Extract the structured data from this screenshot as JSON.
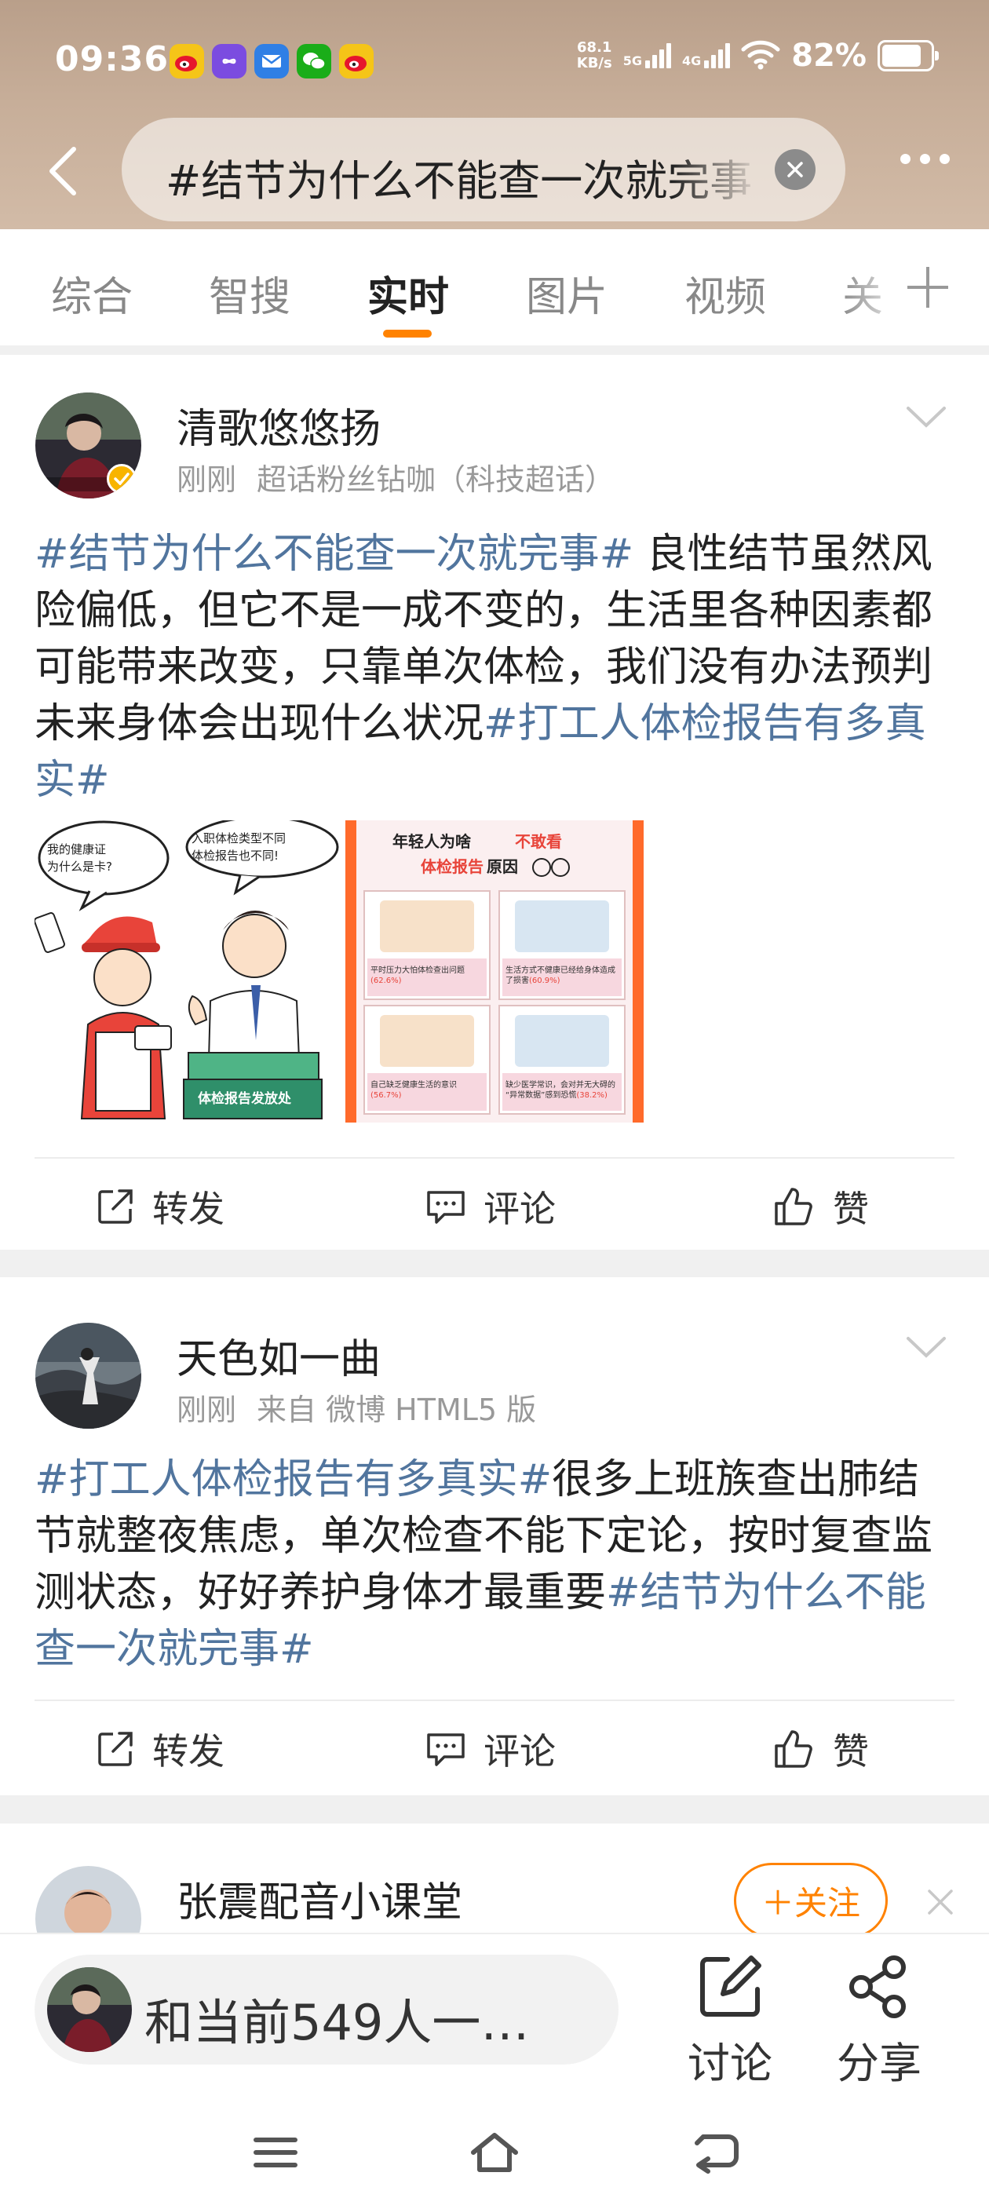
{
  "status_bar": {
    "time": "09:36",
    "net_speed_value": "68.1",
    "net_speed_unit": "KB/s",
    "signal_1": "5G",
    "signal_2": "4G",
    "battery_percent": "82%",
    "battery_level": 0.82,
    "app_icons": [
      "weibo-icon",
      "music-icon",
      "mail-icon",
      "wechat-icon",
      "weibo-icon"
    ]
  },
  "search": {
    "query": "#结节为什么不能查一次就完事"
  },
  "tabs": [
    {
      "label": "综合",
      "active": false
    },
    {
      "label": "智搜",
      "active": false
    },
    {
      "label": "实时",
      "active": true
    },
    {
      "label": "图片",
      "active": false
    },
    {
      "label": "视频",
      "active": false
    },
    {
      "label": "关",
      "active": false
    }
  ],
  "posts": [
    {
      "author": "清歌悠悠扬",
      "time": "刚刚",
      "source": "超话粉丝钻咖（科技超话）",
      "text_parts": [
        {
          "t": "#结节为什么不能查一次就完事#",
          "tag": true
        },
        {
          "t": " 良性结节虽然风险偏低，但它不是一成不变的，生活里各种因素都可能带来改变，只靠单次体检，我们没有办法预判未来身体会出现什么状况",
          "tag": false
        },
        {
          "t": "#打工人体检报告有多真实#",
          "tag": true
        }
      ],
      "image_1": {
        "bubble_left": "我的健康证为什么是卡?",
        "bubble_right": "入职体检类型不同体检报告也不同!",
        "counter_sign": "体检报告发放处"
      },
      "image_2": {
        "title_1": "年轻人为啥",
        "title_highlight_1": "不敢看",
        "title_2": "体检报告",
        "title_highlight_2": "原因",
        "cells": [
          {
            "text": "平时压力大怕体检查出问题",
            "pct": "(62.6%)"
          },
          {
            "text": "生活方式不健康已经给身体造成了损害",
            "pct": "(60.9%)"
          },
          {
            "text": "自己缺乏健康生活的意识",
            "pct": "(56.7%)"
          },
          {
            "text": "缺少医学常识，会对并无大碍的“异常数据”感到恐慌",
            "pct": "(38.2%)"
          }
        ]
      },
      "actions": {
        "repost": "转发",
        "comment": "评论",
        "like": "赞"
      }
    },
    {
      "author": "天色如一曲",
      "time": "刚刚",
      "source": "来自 微博 HTML5 版",
      "text_parts": [
        {
          "t": "#打工人体检报告有多真实#",
          "tag": true
        },
        {
          "t": "很多上班族查出肺结节就整夜焦虑，单次检查不能下定论，按时复查监测状态，好好养护身体才最重要",
          "tag": false
        },
        {
          "t": "#结节为什么不能查一次就完事#",
          "tag": true
        }
      ],
      "actions": {
        "repost": "转发",
        "comment": "评论",
        "like": "赞"
      }
    },
    {
      "author": "张震配音小课堂",
      "follow_label": "＋关注"
    }
  ],
  "bottom_bar": {
    "chat_text": "和当前549人一…",
    "discuss_label": "讨论",
    "share_label": "分享"
  },
  "colors": {
    "accent": "#ff8200",
    "tag": "#51759e",
    "header_gradient_top": "#b99f8a"
  }
}
